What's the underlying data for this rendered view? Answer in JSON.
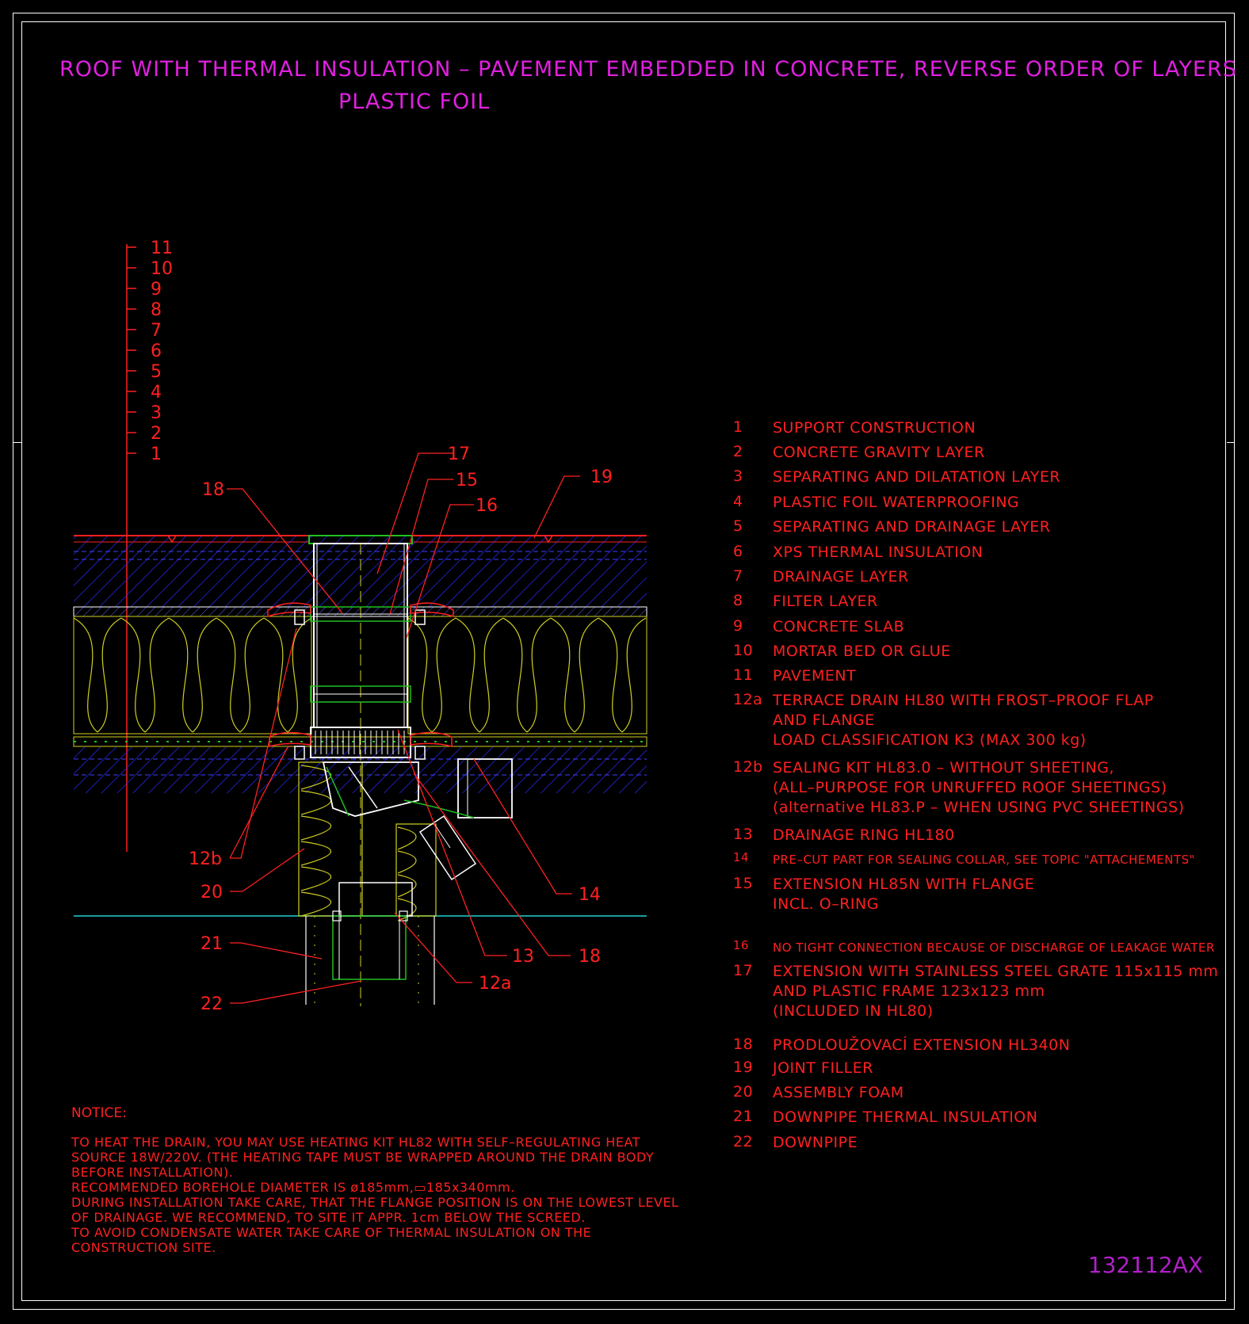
{
  "title": {
    "line1": "ROOF WITH THERMAL INSULATION – PAVEMENT EMBEDDED IN CONCRETE, REVERSE ORDER OF LAYERS",
    "line2": "PLASTIC FOIL"
  },
  "drawing_id": "132112AX",
  "layer_scale": [
    "11",
    "10",
    "9",
    "8",
    "7",
    "6",
    "5",
    "4",
    "3",
    "2",
    "1"
  ],
  "callouts": {
    "c17": "17",
    "c15": "15",
    "c16": "16",
    "c19": "19",
    "c18_top": "18",
    "c12b": "12b",
    "c20": "20",
    "c21": "21",
    "c22": "22",
    "c14": "14",
    "c13": "13",
    "c18_bottom": "18",
    "c12a": "12a"
  },
  "legend": [
    {
      "num": "1",
      "lines": [
        "SUPPORT CONSTRUCTION"
      ]
    },
    {
      "num": "2",
      "lines": [
        "CONCRETE GRAVITY LAYER"
      ]
    },
    {
      "num": "3",
      "lines": [
        "SEPARATING AND DILATATION LAYER"
      ]
    },
    {
      "num": "4",
      "lines": [
        "PLASTIC FOIL WATERPROOFING"
      ]
    },
    {
      "num": "5",
      "lines": [
        "SEPARATING AND DRAINAGE LAYER"
      ]
    },
    {
      "num": "6",
      "lines": [
        "XPS THERMAL INSULATION"
      ]
    },
    {
      "num": "7",
      "lines": [
        "DRAINAGE LAYER"
      ]
    },
    {
      "num": "8",
      "lines": [
        "FILTER LAYER"
      ]
    },
    {
      "num": "9",
      "lines": [
        "CONCRETE SLAB"
      ]
    },
    {
      "num": "10",
      "lines": [
        "MORTAR BED OR GLUE"
      ]
    },
    {
      "num": "11",
      "lines": [
        "PAVEMENT"
      ]
    },
    {
      "num": "12a",
      "lines": [
        "TERRACE DRAIN HL80 WITH FROST–PROOF FLAP",
        "AND FLANGE",
        "LOAD CLASSIFICATION K3 (MAX 300 kg)"
      ]
    },
    {
      "num": "12b",
      "lines": [
        "SEALING KIT HL83.0 – WITHOUT SHEETING,",
        "(ALL–PURPOSE FOR UNRUFFED ROOF SHEETINGS)",
        "(alternative HL83.P – WHEN USING PVC SHEETINGS)"
      ]
    },
    {
      "num": "13",
      "lines": [
        "DRAINAGE RING HL180"
      ]
    },
    {
      "num": "14",
      "lines": [
        "PRE–CUT PART FOR SEALING COLLAR, SEE TOPIC \"ATTACHEMENTS\""
      ]
    },
    {
      "num": "15",
      "lines": [
        "EXTENSION HL85N WITH FLANGE",
        "INCL. O–RING"
      ]
    },
    {
      "num": "16",
      "lines": [
        "NO TIGHT CONNECTION BECAUSE OF DISCHARGE OF LEAKAGE WATER"
      ]
    },
    {
      "num": "17",
      "lines": [
        "EXTENSION WITH STAINLESS STEEL GRATE 115x115 mm",
        "AND PLASTIC FRAME 123x123 mm",
        "(INCLUDED IN HL80)"
      ]
    },
    {
      "num": "18",
      "lines": [
        "PRODLOUŽOVACÍ EXTENSION HL340N"
      ]
    },
    {
      "num": "19",
      "lines": [
        "JOINT FILLER"
      ]
    },
    {
      "num": "20",
      "lines": [
        "ASSEMBLY FOAM"
      ]
    },
    {
      "num": "21",
      "lines": [
        "DOWNPIPE THERMAL INSULATION"
      ]
    },
    {
      "num": "22",
      "lines": [
        "DOWNPIPE"
      ]
    }
  ],
  "notice": {
    "title": "NOTICE:",
    "lines": [
      "TO HEAT THE DRAIN, YOU MAY USE HEATING KIT HL82 WITH SELF–REGULATING HEAT",
      "SOURCE 18W/220V. (THE HEATING TAPE MUST BE WRAPPED AROUND THE DRAIN BODY",
      "BEFORE INSTALLATION).",
      "RECOMMENDED BOREHOLE DIAMETER IS ø185mm,▭185x340mm.",
      "DURING INSTALLATION TAKE CARE, THAT THE FLANGE POSITION IS ON THE LOWEST LEVEL",
      "OF DRAINAGE. WE RECOMMEND, TO SITE IT APPR. 1cm BELOW THE SCREED.",
      "TO AVOID CONDENSATE WATER TAKE CARE OF THERMAL INSULATION ON THE",
      "CONSTRUCTION SITE."
    ]
  },
  "colors": {
    "title": "#e020e0",
    "text": "#ff2020",
    "concrete": "#3030ff",
    "insulation": "#d0d020",
    "drain": "#ffffff",
    "filter": "#20c020",
    "cyan": "#20d0d0"
  }
}
